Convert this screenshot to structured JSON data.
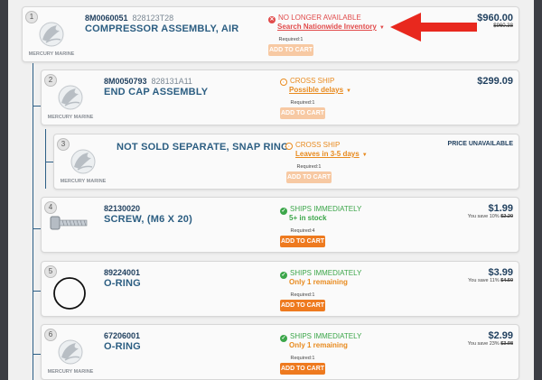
{
  "brand": {
    "logo_text": "MERCURY MARINE"
  },
  "colors": {
    "accent": "#ee7a1f",
    "title": "#2c5e82",
    "red": "#e14b4b",
    "orange": "#e88a1e",
    "green": "#3ca64a",
    "arrow": "#e8281e"
  },
  "items": [
    {
      "index": "1",
      "sku": "8M0060051",
      "alt_sku": "828123T28",
      "title": "COMPRESSOR ASSEMBLY, AIR",
      "image": "mercury-logo",
      "status_icon": "x-icon",
      "status": "NO LONGER AVAILABLE",
      "substatus": "Search Nationwide Inventory",
      "required": "Required:1",
      "button": "ADD TO CART",
      "price": "$960.00",
      "old_price": "$960.38"
    },
    {
      "index": "2",
      "sku": "8M0050793",
      "alt_sku": "828131A11",
      "title": "END CAP ASSEMBLY",
      "image": "mercury-logo",
      "status_icon": "clock-icon",
      "status": "CROSS SHIP",
      "substatus": "Possible delays",
      "required": "Required:1",
      "button": "ADD TO CART",
      "price": "$299.09"
    },
    {
      "index": "3",
      "title": "NOT SOLD SEPARATE, SNAP RING",
      "image": "mercury-logo",
      "status_icon": "clock-icon",
      "status": "CROSS SHIP",
      "substatus": "Leaves in 3-5 days",
      "required": "Required:1",
      "button": "ADD TO CART",
      "price_label": "PRICE UNAVAILABLE"
    },
    {
      "index": "4",
      "sku": "82130020",
      "title": "SCREW, (M6 X 20)",
      "image": "screw",
      "status_icon": "check-icon",
      "status": "SHIPS IMMEDIATELY",
      "substatus": "5+ in stock",
      "required": "Required:4",
      "button": "ADD TO CART",
      "price": "$1.99",
      "save_text": "You save 10%",
      "old_price": "$2.20"
    },
    {
      "index": "5",
      "sku": "89224001",
      "title": "O-RING",
      "image": "o-ring",
      "status_icon": "check-icon",
      "status": "SHIPS IMMEDIATELY",
      "substatus": "Only 1 remaining",
      "required": "Required:1",
      "button": "ADD TO CART",
      "price": "$3.99",
      "save_text": "You save 11%",
      "old_price": "$4.50"
    },
    {
      "index": "6",
      "sku": "67206001",
      "title": "O-RING",
      "image": "mercury-logo",
      "status_icon": "check-icon",
      "status": "SHIPS IMMEDIATELY",
      "substatus": "Only 1 remaining",
      "required": "Required:1",
      "button": "ADD TO CART",
      "price": "$2.99",
      "save_text": "You save 23%",
      "old_price": "$3.98"
    }
  ]
}
